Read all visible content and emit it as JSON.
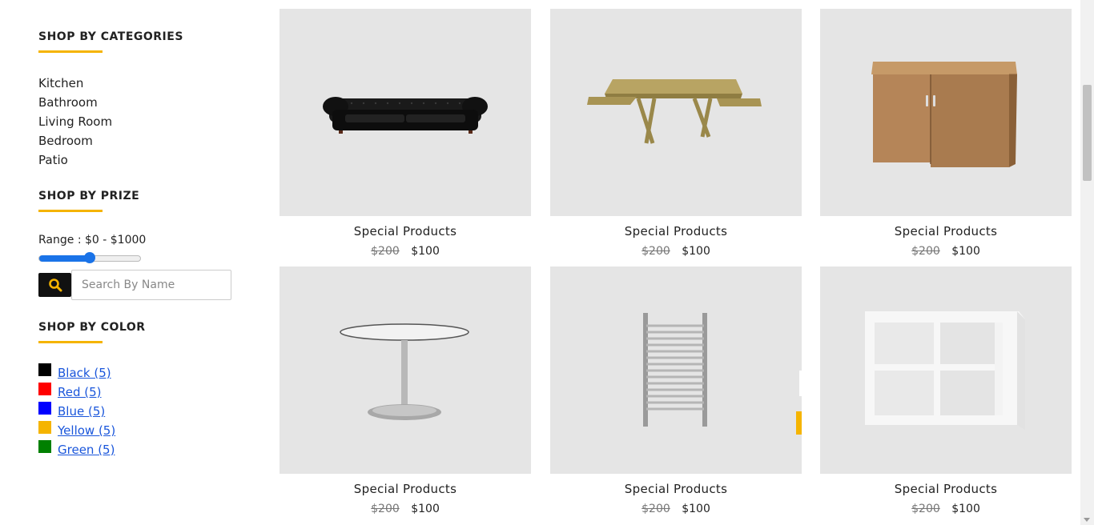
{
  "sidebar": {
    "categories_title": "SHOP BY CATEGORIES",
    "categories": [
      "Kitchen",
      "Bathroom",
      "Living Room",
      "Bedroom",
      "Patio"
    ],
    "price_title": "SHOP BY PRIZE",
    "range_label": "Range : $0 - $1000",
    "slider_value_fraction": 0.5,
    "search_placeholder": "Search By Name",
    "color_title": "SHOP BY COLOR",
    "colors": [
      {
        "label": " Black (5)",
        "hex": "#000000"
      },
      {
        "label": " Red (5)",
        "hex": "#ff0000"
      },
      {
        "label": " Blue (5)",
        "hex": "#0000ff"
      },
      {
        "label": " Yellow (5)",
        "hex": "#f5b400"
      },
      {
        "label": " Green (5)",
        "hex": "#008000"
      }
    ]
  },
  "products": [
    {
      "name": "Special Products",
      "old_price": "$200",
      "price": "$100",
      "image": "black-leather-sofa"
    },
    {
      "name": "Special Products",
      "old_price": "$200",
      "price": "$100",
      "image": "wooden-picnic-table"
    },
    {
      "name": "Special Products",
      "old_price": "$200",
      "price": "$100",
      "image": "wooden-cabinet"
    },
    {
      "name": "Special Products",
      "old_price": "$200",
      "price": "$100",
      "image": "round-pedestal-table"
    },
    {
      "name": "Special Products",
      "old_price": "$200",
      "price": "$100",
      "image": "towel-radiator"
    },
    {
      "name": "Special Products",
      "old_price": "$200",
      "price": "$100",
      "image": "white-cube-shelf"
    }
  ],
  "colors": {
    "accent": "#f5b400",
    "card_bg": "#e5e5e5",
    "link": "#1a56db"
  }
}
